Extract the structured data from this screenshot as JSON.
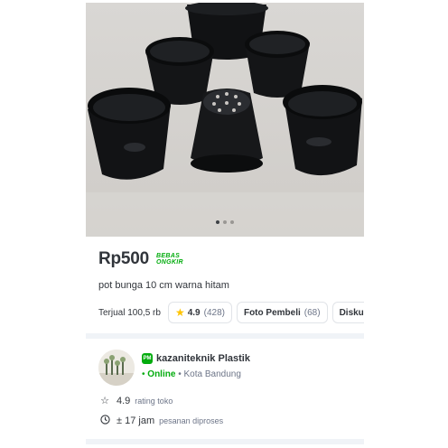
{
  "product": {
    "carousel": {
      "total": 3,
      "active_index": 0
    },
    "price": "Rp500",
    "free_shipping": {
      "line1": "BEBAS",
      "line2": "ONGKIR"
    },
    "title": "pot bunga 10 cm warna hitam",
    "sold": "Terjual 100,5 rb",
    "rating": {
      "value": "4.9",
      "count": "(428)"
    },
    "buyer_photos": {
      "label": "Foto Pembeli",
      "count": "(68)"
    },
    "discussion": {
      "label": "Diskusi"
    }
  },
  "shop": {
    "badge": "PM",
    "name": "kazaniteknik Plastik",
    "status": "Online",
    "separator": "•",
    "city": "Kota Bandung",
    "rating_value": "4.9",
    "rating_label": "rating toko",
    "process_time": "± 17 jam",
    "process_label": "pesanan diproses"
  },
  "colors": {
    "brand_green": "#03ac0e",
    "star": "#ffc400",
    "divider": "#f0f3f7"
  },
  "icons": [
    "star-icon",
    "star-outline-icon",
    "clock-icon",
    "power-merchant-icon"
  ]
}
